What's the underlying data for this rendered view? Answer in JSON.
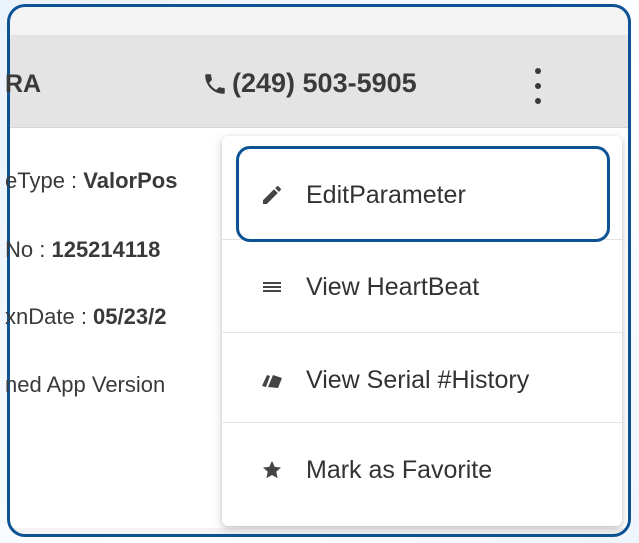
{
  "header": {
    "name": "RA",
    "phone": "(249) 503-5905"
  },
  "details": [
    {
      "label": "eType : ",
      "value": "ValorPos"
    },
    {
      "label": "No : ",
      "value": "125214118"
    },
    {
      "label": "xnDate : ",
      "value": "05/23/2"
    },
    {
      "label": "ned App Version",
      "value": ""
    }
  ],
  "menu": {
    "items": [
      {
        "label": "EditParameter",
        "icon": "pencil-icon"
      },
      {
        "label": "View HeartBeat",
        "icon": "list-icon"
      },
      {
        "label": "View Serial #History",
        "icon": "history-icon"
      },
      {
        "label": "Mark as Favorite",
        "icon": "star-icon"
      }
    ]
  },
  "colors": {
    "accent": "#0b5394",
    "text": "#333333"
  }
}
